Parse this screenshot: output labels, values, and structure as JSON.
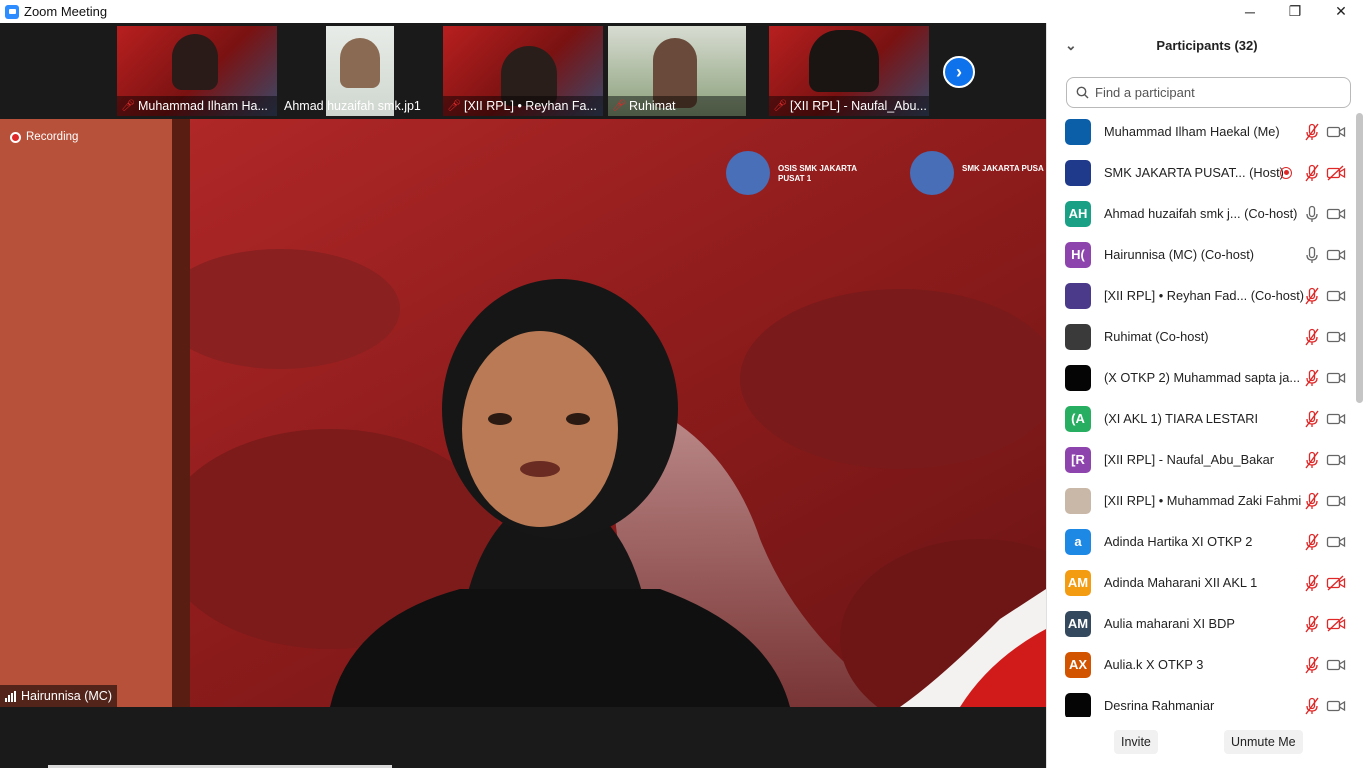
{
  "window": {
    "title": "Zoom Meeting",
    "minimize_label": "─",
    "maximize_label": "❐",
    "close_label": "✕"
  },
  "thumbnails": [
    {
      "name": "Muhammad Ilham Ha...",
      "muted": true
    },
    {
      "name": "Ahmad huzaifah smk.jp1",
      "muted": false
    },
    {
      "name": "[XII RPL] • Reyhan Fa...",
      "muted": true
    },
    {
      "name": "Ruhimat",
      "muted": true
    },
    {
      "name": "[XII RPL] - Naufal_Abu...",
      "muted": true
    }
  ],
  "next_arrow_label": "›",
  "main_video": {
    "recording_label": "Recording",
    "speaker_name": "Hairunnisa (MC)",
    "banner_text_1": "OSIS SMK JAKARTA PUSAT 1",
    "banner_text_2": "SMK JAKARTA PUSA"
  },
  "panel": {
    "title": "Participants (32)",
    "collapse_icon": "⌄",
    "search_placeholder": "Find a participant",
    "invite_label": "Invite",
    "unmute_label": "Unmute Me"
  },
  "participants": [
    {
      "name": "Muhammad Ilham Haekal (Me)",
      "initials": "",
      "color": "#0b5fa8",
      "mic": "off",
      "cam": "on",
      "rec": false
    },
    {
      "name": "SMK JAKARTA PUSAT... (Host)",
      "initials": "",
      "color": "#1f3a8a",
      "mic": "off",
      "cam": "off",
      "rec": true
    },
    {
      "name": "Ahmad huzaifah smk j... (Co-host)",
      "initials": "AH",
      "color": "#1aa085",
      "mic": "on",
      "cam": "on",
      "rec": false
    },
    {
      "name": "Hairunnisa (MC) (Co-host)",
      "initials": "H(",
      "color": "#8e44ad",
      "mic": "on",
      "cam": "on",
      "rec": false
    },
    {
      "name": "[XII RPL] • Reyhan Fad... (Co-host)",
      "initials": "",
      "color": "#4b3a8a",
      "mic": "off",
      "cam": "on",
      "rec": false
    },
    {
      "name": "Ruhimat (Co-host)",
      "initials": "",
      "color": "#3a3a3a",
      "mic": "off",
      "cam": "on",
      "rec": false
    },
    {
      "name": "(X OTKP 2) Muhammad sapta ja...",
      "initials": "",
      "color": "#050505",
      "mic": "off",
      "cam": "on",
      "rec": false
    },
    {
      "name": "(XI AKL 1) TIARA LESTARI",
      "initials": "(A",
      "color": "#27ae60",
      "mic": "off",
      "cam": "on",
      "rec": false
    },
    {
      "name": "[XII RPL] - Naufal_Abu_Bakar",
      "initials": "[R",
      "color": "#8e44ad",
      "mic": "off",
      "cam": "on",
      "rec": false
    },
    {
      "name": "[XII RPL] • Muhammad Zaki Fahmi",
      "initials": "",
      "color": "#c9b8a8",
      "mic": "off",
      "cam": "on",
      "rec": false
    },
    {
      "name": "Adinda Hartika XI OTKP 2",
      "initials": "a",
      "color": "#1e88e5",
      "mic": "off",
      "cam": "on",
      "rec": false
    },
    {
      "name": "Adinda Maharani XII AKL 1",
      "initials": "AM",
      "color": "#f39c12",
      "mic": "off",
      "cam": "off",
      "rec": false
    },
    {
      "name": "Aulia maharani XI BDP",
      "initials": "AM",
      "color": "#34495e",
      "mic": "off",
      "cam": "off",
      "rec": false
    },
    {
      "name": "Aulia.k X OTKP 3",
      "initials": "AX",
      "color": "#d35400",
      "mic": "off",
      "cam": "on",
      "rec": false
    },
    {
      "name": "Desrina Rahmaniar",
      "initials": "",
      "color": "#050505",
      "mic": "off",
      "cam": "on",
      "rec": false
    }
  ]
}
